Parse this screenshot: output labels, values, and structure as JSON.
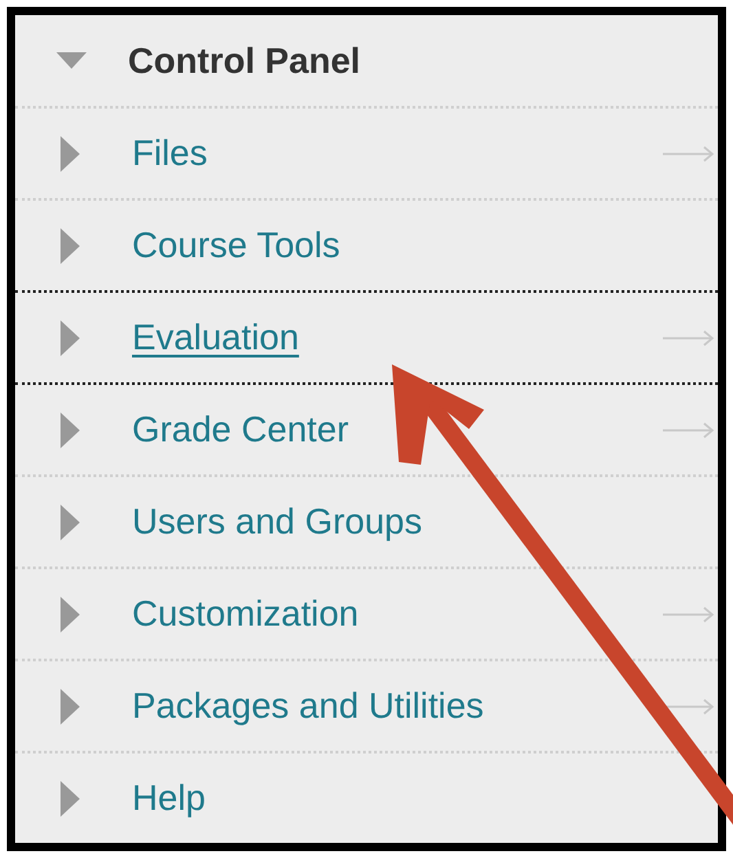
{
  "panel": {
    "title": "Control Panel",
    "expanded": true,
    "items": [
      {
        "label": "Files",
        "highlighted": false,
        "has_arrow": true
      },
      {
        "label": "Course Tools",
        "highlighted": false,
        "has_arrow": false
      },
      {
        "label": "Evaluation",
        "highlighted": true,
        "has_arrow": true
      },
      {
        "label": "Grade Center",
        "highlighted": false,
        "has_arrow": true
      },
      {
        "label": "Users and Groups",
        "highlighted": false,
        "has_arrow": false
      },
      {
        "label": "Customization",
        "highlighted": false,
        "has_arrow": true
      },
      {
        "label": "Packages and Utilities",
        "highlighted": false,
        "has_arrow": true
      },
      {
        "label": "Help",
        "highlighted": false,
        "has_arrow": false
      }
    ]
  }
}
